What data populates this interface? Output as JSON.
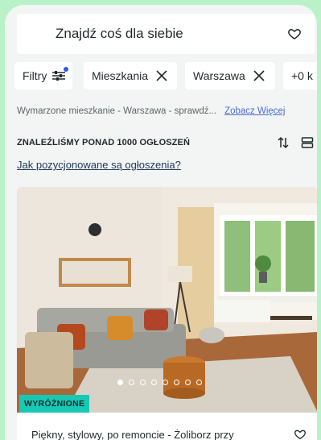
{
  "search": {
    "label": "Znajdź coś dla siebie"
  },
  "filters": [
    {
      "label": "Filtry"
    },
    {
      "label": "Mieszkania"
    },
    {
      "label": "Warszawa"
    },
    {
      "label": "+0 k"
    }
  ],
  "saved_search": {
    "text": "Wymarzone mieszkanie - Warszawa - sprawdź...",
    "link": "Zobacz Więcej"
  },
  "results": {
    "count_label": "ZNALEŹLIŚMY PONAD 1000 OGŁOSZEŃ",
    "how_link": "Jak pozycjonowane są ogłoszenia?"
  },
  "listing": {
    "badge": "WYRÓŻNIONE",
    "title": "Piękny, stylowy, po remoncie - Żoliborz przy",
    "photo_count": 8,
    "active_photo": 1
  },
  "colors": {
    "background": "#b9f2c9",
    "accent": "#17c8b5",
    "link": "#4a6ecf"
  },
  "icons": [
    "heart-icon",
    "filter-sliders-icon",
    "close-icon",
    "sort-icon",
    "list-view-icon"
  ]
}
